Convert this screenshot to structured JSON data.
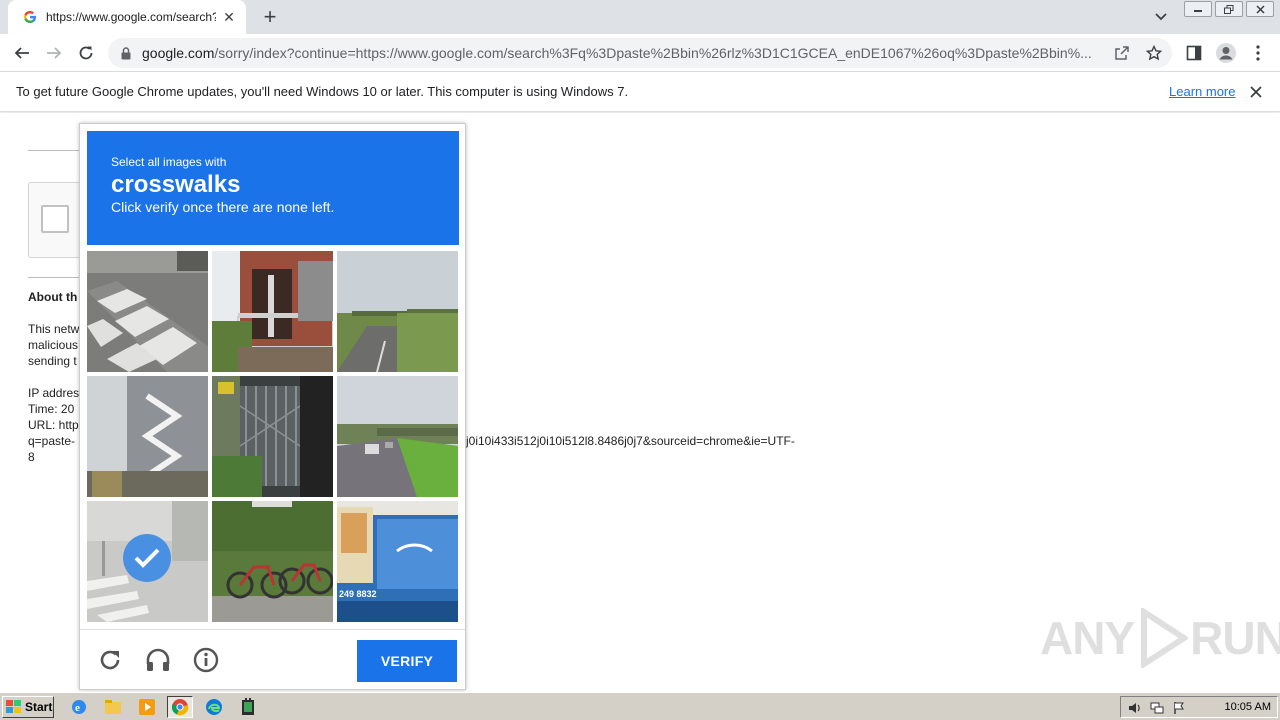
{
  "browser": {
    "tab_title": "https://www.google.com/search?q=",
    "url_host": "google.com",
    "url_path": "/sorry/index?continue=https://www.google.com/search%3Fq%3Dpaste%2Bbin%26rlz%3D1C1GCEA_enDE1067%26oq%3Dpaste%2Bbin%...",
    "new_tab_label": "+",
    "tab_close_label": "✕"
  },
  "infobar": {
    "message": "To get future Google Chrome updates, you'll need Windows 10 or later. This computer is using Windows 7.",
    "learn_more": "Learn more"
  },
  "sorry_page": {
    "about_heading": "About th",
    "para_lines": [
      "This netw",
      "malicious",
      "sending t"
    ],
    "ip_label": "IP addres",
    "time_label": "Time: 20",
    "url_label": "URL: http",
    "url_line2_prefix": "q=paste-",
    "url_line2_suffix": "j0i10i433i512j0i10i512l8.8486j0j7&sourceid=chrome&ie=UTF-",
    "url_line3": "8"
  },
  "challenge": {
    "instruction_line1": "Select all images with",
    "target": "crosswalks",
    "instruction_line3": "Click verify once there are none left.",
    "tiles": [
      {
        "name": "tile-crosswalk-road",
        "selected": false
      },
      {
        "name": "tile-brick-balcony",
        "selected": false
      },
      {
        "name": "tile-rural-highway-bridge",
        "selected": false
      },
      {
        "name": "tile-building-fire-escape",
        "selected": false
      },
      {
        "name": "tile-metal-gate",
        "selected": false
      },
      {
        "name": "tile-highway-car",
        "selected": false
      },
      {
        "name": "tile-faded-crosswalk",
        "selected": true
      },
      {
        "name": "tile-bicycles",
        "selected": false
      },
      {
        "name": "tile-truck-side",
        "selected": false
      }
    ],
    "truck_text": "249 8832",
    "verify_label": "VERIFY"
  },
  "watermark": {
    "text_left": "ANY",
    "text_right": "RUN"
  },
  "taskbar": {
    "start_label": "Start",
    "clock": "10:05 AM"
  },
  "colors": {
    "accent": "#1a73e8",
    "check_blue": "#4a90e2",
    "taskbar": "#d4d0c8"
  }
}
